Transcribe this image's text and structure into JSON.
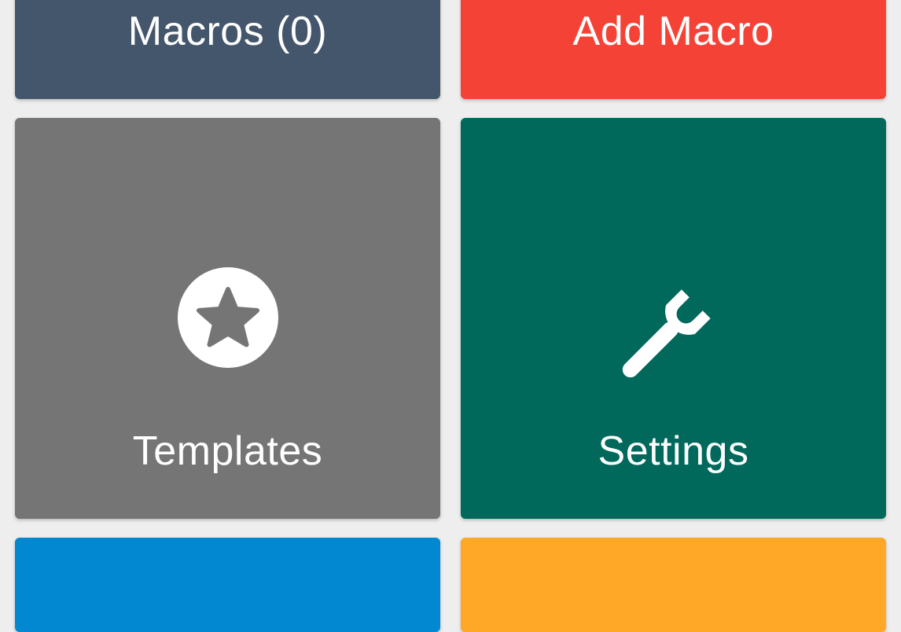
{
  "tiles": {
    "macros": {
      "label": "Macros (0)",
      "color": "#44566c"
    },
    "add_macro": {
      "label": "Add Macro",
      "color": "#f44336"
    },
    "templates": {
      "label": "Templates",
      "icon": "star-circle-icon",
      "color": "#757575"
    },
    "settings": {
      "label": "Settings",
      "icon": "wrench-icon",
      "color": "#00695c"
    },
    "bottom_left": {
      "color": "#0288d1"
    },
    "bottom_right": {
      "color": "#ffa726"
    }
  }
}
